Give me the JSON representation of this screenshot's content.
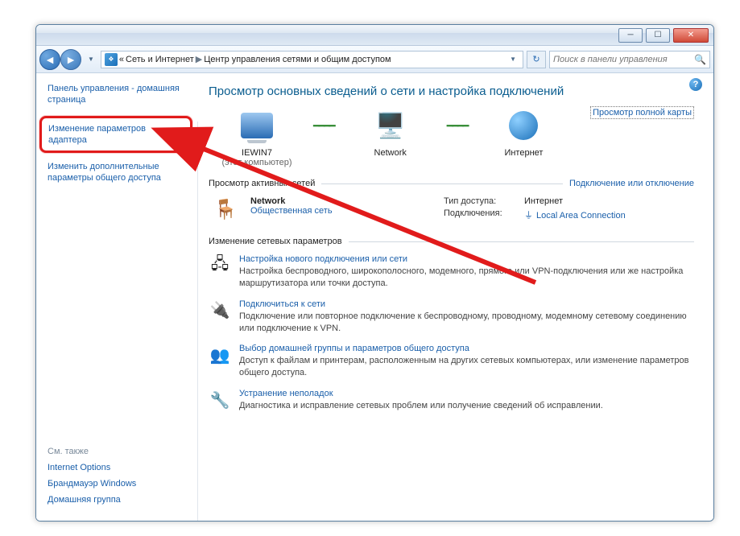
{
  "breadcrumb": {
    "chevron": "«",
    "item1": "Сеть и Интернет",
    "item2": "Центр управления сетями и общим доступом"
  },
  "search": {
    "placeholder": "Поиск в панели управления"
  },
  "sidebar": {
    "cp_home": "Панель управления - домашняя страница",
    "link_adapter": "Изменение параметров адаптера",
    "link_sharing": "Изменить дополнительные параметры общего доступа",
    "see_also_header": "См. также",
    "see_also": {
      "internet_options": "Internet Options",
      "firewall": "Брандмауэр Windows",
      "homegroup": "Домашняя группа"
    }
  },
  "main": {
    "title": "Просмотр основных сведений о сети и настройка подключений",
    "full_map": "Просмотр полной карты",
    "node_pc": {
      "name": "IEWIN7",
      "sub": "(этот компьютер)"
    },
    "node_net": {
      "name": "Network"
    },
    "node_inet": {
      "name": "Интернет"
    },
    "section_active": "Просмотр активных сетей",
    "connect_toggle": "Подключение или отключение",
    "network": {
      "name": "Network",
      "category": "Общественная сеть",
      "access_label": "Тип доступа:",
      "access_value": "Интернет",
      "conn_label": "Подключения:",
      "conn_value": "Local Area Connection"
    },
    "section_change": "Изменение сетевых параметров",
    "actions": {
      "a1": {
        "title": "Настройка нового подключения или сети",
        "desc": "Настройка беспроводного, широкополосного, модемного, прямого или VPN-подключения или же настройка маршрутизатора или точки доступа."
      },
      "a2": {
        "title": "Подключиться к сети",
        "desc": "Подключение или повторное подключение к беспроводному, проводному, модемному сетевому соединению или подключение к VPN."
      },
      "a3": {
        "title": "Выбор домашней группы и параметров общего доступа",
        "desc": "Доступ к файлам и принтерам, расположенным на других сетевых компьютерах, или изменение параметров общего доступа."
      },
      "a4": {
        "title": "Устранение неполадок",
        "desc": "Диагностика и исправление сетевых проблем или получение сведений об исправлении."
      }
    }
  }
}
